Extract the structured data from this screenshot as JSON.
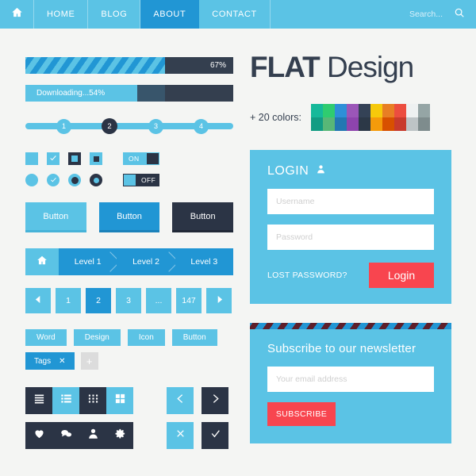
{
  "navbar": {
    "home_icon": "home-icon",
    "items": [
      {
        "label": "HOME",
        "active": false
      },
      {
        "label": "BLOG",
        "active": false
      },
      {
        "label": "ABOUT",
        "active": true
      },
      {
        "label": "CONTACT",
        "active": false
      }
    ],
    "search_placeholder": "Search...",
    "search_icon": "search-icon",
    "bg": "#5bc3e5",
    "active_bg": "#2196d4"
  },
  "progress": {
    "striped": {
      "percent_label": "67%",
      "percent": 67
    },
    "download": {
      "label": "Downloading...54%",
      "percent": 54
    }
  },
  "steps": {
    "items": [
      "1",
      "2",
      "3",
      "4"
    ],
    "current": "2"
  },
  "controls": {
    "checkboxes": [
      "checkbox-empty",
      "checkbox-checked",
      "checkbox-dark-inner",
      "checkbox-light-inner"
    ],
    "radios": [
      "radio-empty",
      "radio-checked",
      "radio-dot",
      "radio-ring"
    ],
    "toggle_on_label": "ON",
    "toggle_off_label": "OFF"
  },
  "buttons": [
    {
      "label": "Button",
      "style": "light"
    },
    {
      "label": "Button",
      "style": "mid"
    },
    {
      "label": "Button",
      "style": "dark"
    }
  ],
  "breadcrumb": {
    "home_icon": "home-icon",
    "levels": [
      "Level 1",
      "Level 2",
      "Level 3"
    ]
  },
  "pagination": {
    "prev_icon": "caret-left-icon",
    "next_icon": "caret-right-icon",
    "pages": [
      "1",
      "2",
      "3",
      "...",
      "147"
    ],
    "active": "2"
  },
  "tags": {
    "row1": [
      "Word",
      "Design",
      "Icon",
      "Button"
    ],
    "selected": {
      "label": "Tags",
      "remove_icon": "close-icon",
      "remove_label": "✕"
    },
    "add_label": "+"
  },
  "view_switcher": {
    "items": [
      "list-lines-icon",
      "list-bullets-icon",
      "grid-dots-icon",
      "grid-squares-icon"
    ]
  },
  "nav_arrows": {
    "prev_icon": "chevron-left-icon",
    "next_icon": "chevron-right-icon"
  },
  "social_bar": {
    "items": [
      "heart-icon",
      "comment-icon",
      "user-icon",
      "gear-icon"
    ]
  },
  "action_buttons": {
    "close_icon": "close-icon",
    "check_icon": "check-icon"
  },
  "logo": {
    "bold": "FLAT",
    "thin": " Design"
  },
  "palette": {
    "label": "+ 20 colors:",
    "columns": [
      {
        "top": "#16b99a",
        "bottom": "#129c83"
      },
      {
        "top": "#2fcc70",
        "bottom": "#58b777"
      },
      {
        "top": "#2e8fd8",
        "bottom": "#2277b2"
      },
      {
        "top": "#9b56b8",
        "bottom": "#8e44ad"
      },
      {
        "top": "#344256",
        "bottom": "#2c3847"
      },
      {
        "top": "#f6c90b",
        "bottom": "#f59b0b"
      },
      {
        "top": "#e87e24",
        "bottom": "#d85000"
      },
      {
        "top": "#ec4d3f",
        "bottom": "#c83a2c"
      },
      {
        "top": "#eef1f1",
        "bottom": "#bdc4c6"
      },
      {
        "top": "#95a5a5",
        "bottom": "#7e8c8d"
      }
    ]
  },
  "login": {
    "title": "LOGIN",
    "user_icon": "user-icon",
    "username_placeholder": "Username",
    "password_placeholder": "Password",
    "lost_password": "LOST PASSWORD?",
    "submit_label": "Login",
    "submit_color": "#f8454f"
  },
  "newsletter": {
    "title": "Subscribe to our newsletter",
    "email_placeholder": "Your email address",
    "submit_label": "SUBSCRIBE",
    "submit_color": "#f8454f"
  }
}
